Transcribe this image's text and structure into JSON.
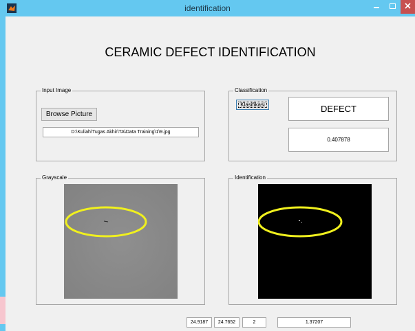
{
  "window": {
    "title": "identification",
    "colors": {
      "titlebar": "#64c8f0",
      "close": "#c75050",
      "background": "#f0f0f0",
      "highlight": "#f0f01e"
    },
    "icons": {
      "app": "matlab-icon",
      "minimize": "minimize-icon",
      "maximize": "maximize-icon",
      "close": "close-icon"
    }
  },
  "header": {
    "title": "CERAMIC DEFECT IDENTIFICATION"
  },
  "input_panel": {
    "title": "Input Image",
    "browse_label": "Browse Picture",
    "path": "D:\\Kuliah\\Tugas Akhir\\TA\\Data Training\\1\\9.jpg"
  },
  "classification_panel": {
    "title": "Classification",
    "button_label": "Klasifikasi",
    "result": "DEFECT",
    "score": "0.407878"
  },
  "grayscale_panel": {
    "title": "Grayscale"
  },
  "identification_panel": {
    "title": "Identification"
  },
  "stats": {
    "v1": "24.9187",
    "v2": "24.7652",
    "v3": "2",
    "v4": "1.37207"
  }
}
